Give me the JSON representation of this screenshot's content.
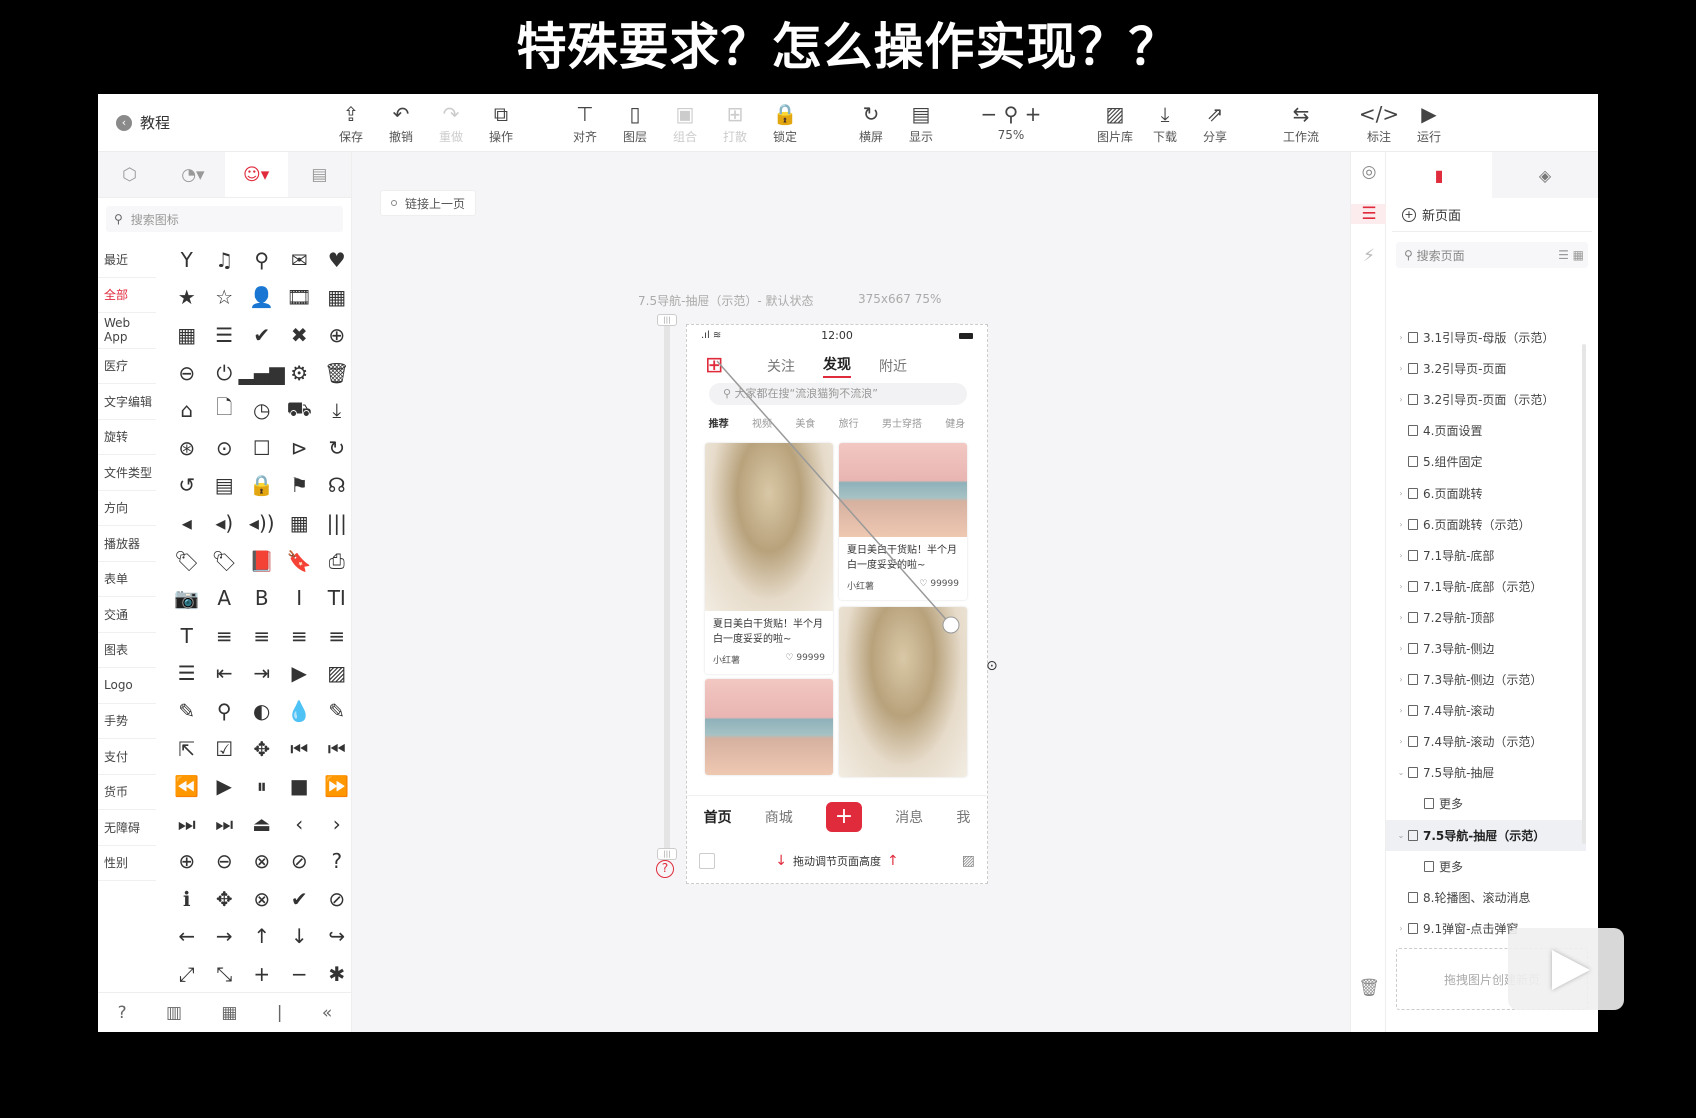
{
  "caption": "特殊要求？怎么操作实现？？",
  "header": {
    "back_label": "教程",
    "tools": [
      {
        "label": "保存",
        "icon": "⇪",
        "disabled": false
      },
      {
        "label": "撤销",
        "icon": "↶",
        "disabled": false
      },
      {
        "label": "重做",
        "icon": "↷",
        "disabled": true
      },
      {
        "label": "操作",
        "icon": "⧉",
        "disabled": false
      },
      {
        "label": "对齐",
        "icon": "⊤",
        "disabled": false
      },
      {
        "label": "图层",
        "icon": "▯",
        "disabled": false
      },
      {
        "label": "组合",
        "icon": "▣",
        "disabled": true
      },
      {
        "label": "打散",
        "icon": "⊞",
        "disabled": true
      },
      {
        "label": "锁定",
        "icon": "🔒",
        "disabled": false
      },
      {
        "label": "横屏",
        "icon": "↻",
        "disabled": false
      },
      {
        "label": "显示",
        "icon": "▤",
        "disabled": false
      },
      {
        "label": "75%",
        "icon": "−  ⚲  +",
        "disabled": false
      },
      {
        "label": "图片库",
        "icon": "▨",
        "disabled": false
      },
      {
        "label": "下载",
        "icon": "⤓",
        "disabled": false
      },
      {
        "label": "分享",
        "icon": "⇗",
        "disabled": false
      },
      {
        "label": "工作流",
        "icon": "⇆",
        "disabled": false
      },
      {
        "label": "标注",
        "icon": "</>",
        "disabled": false
      },
      {
        "label": "运行",
        "icon": "▶",
        "disabled": false
      }
    ]
  },
  "left_panel": {
    "search_placeholder": "搜索图标",
    "categories": [
      "最近",
      "全部",
      "Web App",
      "医疗",
      "文字编辑",
      "旋转",
      "文件类型",
      "方向",
      "播放器",
      "表单",
      "交通",
      "图表",
      "Logo",
      "手势",
      "支付",
      "货币",
      "无障碍",
      "性别"
    ],
    "active_category": "全部",
    "icons": [
      "Y",
      "♫",
      "⚲",
      "✉",
      "♥",
      "★",
      "☆",
      "👤",
      "🎞",
      "▦",
      "▦",
      "☰",
      "✔",
      "✖",
      "⊕",
      "⊖",
      "⏻",
      "▂▄▆",
      "⚙",
      "🗑",
      "⌂",
      "🗋",
      "◷",
      "⛟",
      "⤓",
      "⊛",
      "⊙",
      "☐",
      "⊳",
      "↻",
      "↺",
      "▤",
      "🔒",
      "⚑",
      "☊",
      "◂",
      "◂)",
      "◂))",
      "▦",
      "|||",
      "🏷",
      "🏷",
      "📕",
      "🔖",
      "⎙",
      "📷",
      "A",
      "B",
      "I",
      "TI",
      "T",
      "≡",
      "≡",
      "≡",
      "≡",
      "☰",
      "⇤",
      "⇥",
      "▶",
      "▨",
      "✎",
      "⚲",
      "◐",
      "💧",
      "✎",
      "⇱",
      "☑",
      "✥",
      "⏮",
      "⏮",
      "⏪",
      "▶",
      "⏸",
      "■",
      "⏩",
      "⏭",
      "⏭",
      "⏏",
      "‹",
      "›",
      "⊕",
      "⊖",
      "⊗",
      "⊘",
      "?",
      "ℹ",
      "✥",
      "⊗",
      "✔",
      "⊘",
      "←",
      "→",
      "↑",
      "↓",
      "↪",
      "⤢",
      "⤡",
      "+",
      "−",
      "✱"
    ],
    "footer": [
      "?",
      "▥",
      "▦",
      "|",
      "«"
    ]
  },
  "canvas": {
    "link_prev": "链接上一页",
    "phone_label": "7.5导航-抽屉（示范）- 默认状态",
    "phone_size": "375x667 75%",
    "phone": {
      "time": "12:00",
      "tabs": [
        "关注",
        "发现",
        "附近"
      ],
      "search_placeholder": "大家都在搜“流浪猫狗不流浪”",
      "cats": [
        "推荐",
        "视频",
        "美食",
        "旅行",
        "男士穿搭",
        "健身"
      ],
      "card_title": "夏日美白干货贴！半个月白一度妥妥的啦~",
      "card_user": "小红薯",
      "card_likes": "99999",
      "bottom_nav": [
        "首页",
        "商城",
        "+",
        "消息",
        "我"
      ],
      "footer_hint": "拖动调节页面高度"
    }
  },
  "right_panel": {
    "new_page": "新页面",
    "search_placeholder": "搜索页面",
    "pages": [
      {
        "name": "3.1引导页-母版（示范）",
        "caret": "›",
        "indent": 0,
        "selected": false
      },
      {
        "name": "3.2引导页-页面",
        "caret": "›",
        "indent": 0,
        "selected": false
      },
      {
        "name": "3.2引导页-页面（示范）",
        "caret": "›",
        "indent": 0,
        "selected": false
      },
      {
        "name": "4.页面设置",
        "caret": "",
        "indent": 0,
        "selected": false
      },
      {
        "name": "5.组件固定",
        "caret": "",
        "indent": 0,
        "selected": false
      },
      {
        "name": "6.页面跳转",
        "caret": "›",
        "indent": 0,
        "selected": false
      },
      {
        "name": "6.页面跳转（示范）",
        "caret": "›",
        "indent": 0,
        "selected": false
      },
      {
        "name": "7.1导航-底部",
        "caret": "›",
        "indent": 0,
        "selected": false
      },
      {
        "name": "7.1导航-底部（示范）",
        "caret": "›",
        "indent": 0,
        "selected": false
      },
      {
        "name": "7.2导航-顶部",
        "caret": "›",
        "indent": 0,
        "selected": false
      },
      {
        "name": "7.3导航-侧边",
        "caret": "›",
        "indent": 0,
        "selected": false
      },
      {
        "name": "7.3导航-侧边（示范）",
        "caret": "›",
        "indent": 0,
        "selected": false
      },
      {
        "name": "7.4导航-滚动",
        "caret": "›",
        "indent": 0,
        "selected": false
      },
      {
        "name": "7.4导航-滚动（示范）",
        "caret": "›",
        "indent": 0,
        "selected": false
      },
      {
        "name": "7.5导航-抽屉",
        "caret": "⌄",
        "indent": 0,
        "selected": false
      },
      {
        "name": "更多",
        "caret": "",
        "indent": 1,
        "selected": false
      },
      {
        "name": "7.5导航-抽屉（示范）",
        "caret": "⌄",
        "indent": 0,
        "selected": true
      },
      {
        "name": "更多",
        "caret": "",
        "indent": 1,
        "selected": false
      },
      {
        "name": "8.轮播图、滚动消息",
        "caret": "",
        "indent": 0,
        "selected": false
      },
      {
        "name": "9.1弹窗-点击弹窗",
        "caret": "›",
        "indent": 0,
        "selected": false
      }
    ],
    "dropzone": "拖拽图片创建新页"
  }
}
